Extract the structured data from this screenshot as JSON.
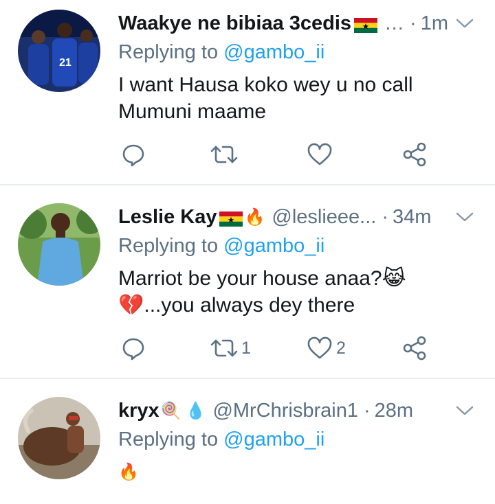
{
  "tweets": [
    {
      "name": "Waakye ne bibiaa 3cedis",
      "handle": "…",
      "time": "1m",
      "reply_prefix": "Replying to ",
      "reply_to": "@gambo_ii",
      "text_lines": [
        "I want Hausa koko wey u no call",
        "Mumuni maame"
      ],
      "retweets": "",
      "likes": ""
    },
    {
      "name": "Leslie Kay",
      "handle": "@leslieee...",
      "time": "34m",
      "reply_prefix": "Replying to ",
      "reply_to": "@gambo_ii",
      "text_lines": [
        "Marriot be your house anaa?😹",
        "💔...you always dey there"
      ],
      "retweets": "1",
      "likes": "2"
    },
    {
      "name": "kryx",
      "handle": "@MrChrisbrain1",
      "time": "28m",
      "reply_prefix": "Replying to ",
      "reply_to": "@gambo_ii",
      "text_lines": [
        "🔥"
      ],
      "retweets": "",
      "likes": ""
    }
  ],
  "separator": "·",
  "emojis": {
    "fire": "🔥",
    "lollipop": "🍭",
    "droplet": "💧"
  },
  "colors": {
    "accent": "#1da1f2",
    "muted": "#5b7083",
    "text": "#14171a",
    "divider": "#e6ecf0"
  },
  "icons": [
    "reply-icon",
    "retweet-icon",
    "like-icon",
    "share-icon",
    "chevron-down-icon"
  ]
}
